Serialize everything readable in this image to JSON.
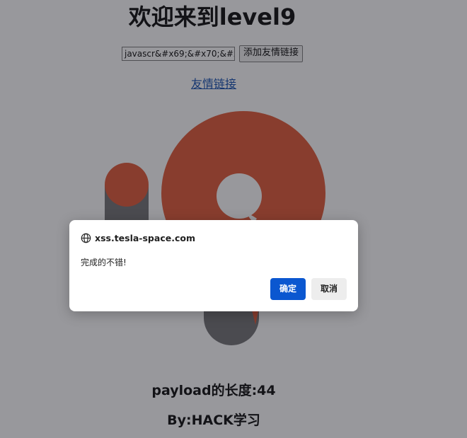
{
  "page": {
    "title": "欢迎来到level9",
    "input_value": "javascr&#x69;&#x70;&#x",
    "add_button_label": "添加友情链接",
    "friend_link_text": "友情链接",
    "payload_length_text": "payload的长度:44",
    "byline_text": "By:HACK学习"
  },
  "logo": {
    "icon": "orange-nine-logo-icon",
    "primary_color": "#e0512c",
    "secondary_color": "#6b6b6d"
  },
  "dialog": {
    "origin": "xss.tesla-space.com",
    "origin_icon": "globe-icon",
    "message": "完成的不错!",
    "ok_label": "确定",
    "cancel_label": "取消",
    "ok_color": "#0b57d0"
  }
}
